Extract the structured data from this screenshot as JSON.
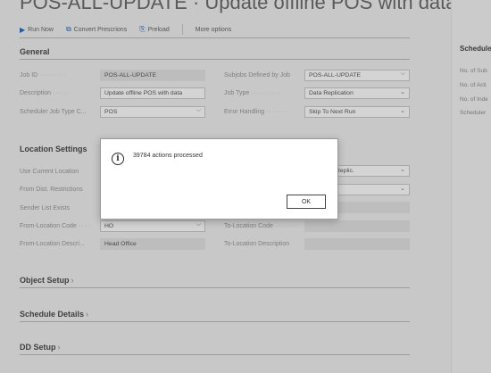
{
  "page": {
    "title": "POS-ALL-UPDATE · Update offline POS with data"
  },
  "toolbar": {
    "run_now": "Run Now",
    "convert_prescriptions": "Convert Prescrions",
    "preload": "Preload",
    "more_options": "More options"
  },
  "general": {
    "title": "General",
    "job_id": {
      "label": "Job ID",
      "value": "POS-ALL-UPDATE"
    },
    "description": {
      "label": "Description",
      "value": "Update offline POS with data"
    },
    "scheduler_job_type": {
      "label": "Scheduler Job Type C...",
      "value": "POS"
    },
    "subjobs_defined_by_job": {
      "label": "Subjobs Defined by Job",
      "value": "POS-ALL-UPDATE"
    },
    "job_type": {
      "label": "Job Type",
      "value": "Data Replication"
    },
    "error_handling": {
      "label": "Error Handling",
      "value": "Skip To Next Run"
    }
  },
  "location": {
    "title": "Location Settings",
    "use_current_location": {
      "label": "Use Current Location"
    },
    "from_dist_restrictions": {
      "label": "From Dist. Restrictions"
    },
    "sender_list_exists": {
      "label": "Sender List Exists"
    },
    "from_location_code": {
      "label": "From-Location Code",
      "value": "HO"
    },
    "from_location_description": {
      "label": "From-Location Descri...",
      "value": "Head Office"
    },
    "right_field_1_value": "Replic.",
    "right_field_2_value": "",
    "to_location_code": {
      "label": "To-Location Code",
      "value": ""
    },
    "to_location_description": {
      "label": "To-Location Description",
      "value": ""
    }
  },
  "sections": {
    "object_setup": "Object Setup",
    "schedule_details": "Schedule Details",
    "dd_setup": "DD Setup"
  },
  "right_pane": {
    "title": "Schedule",
    "labels": [
      "No. of Sub",
      "No. of Acti",
      "No. of Inde",
      "Scheduler"
    ]
  },
  "dialog": {
    "message": "39784 actions processed",
    "ok_label": "OK"
  }
}
